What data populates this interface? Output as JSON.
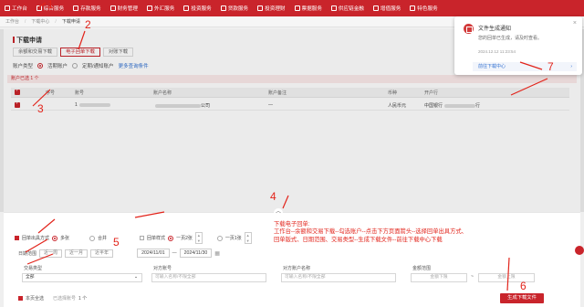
{
  "nav": {
    "items": [
      "工作台",
      "综合服务",
      "存款服务",
      "财务管理",
      "外汇服务",
      "投资服务",
      "贷款服务",
      "投资理财",
      "票据服务",
      "供应链金融",
      "增值服务",
      "特色服务"
    ]
  },
  "breadcrumb": {
    "items": [
      "工作台",
      "下载中心",
      "下载申请"
    ]
  },
  "panel": {
    "title": "下载申请",
    "tabs": [
      "余额和交易下载",
      "电子回单下载",
      "对账下载"
    ],
    "account_type_label": "账户类型",
    "account_opt1": "活期账户",
    "account_opt2": "定期/通知账户",
    "more_link": "更多查询条件",
    "selected_text": "账户已选 1 个"
  },
  "table": {
    "headers": [
      "序号",
      "账号",
      "账户名称",
      "账户备注",
      "币种",
      "开户行"
    ],
    "rows": [
      {
        "index": "1",
        "account": "1",
        "name": "公司",
        "remark": "—",
        "currency": "人民币元",
        "bank": "中国银行",
        "bank_tail": "行"
      }
    ]
  },
  "bottom": {
    "fold_icon": "chevron-up-icon",
    "output_label": "回单出具方式",
    "output_opt1": "多张",
    "output_opt2": "合并",
    "style_label": "回单样式",
    "style_opt1": "一页2张",
    "style_opt2": "一页1张",
    "range_label": "日期范围",
    "range_opts": [
      "近一周",
      "近一月",
      "近半年"
    ],
    "date_start": "2024/11/01",
    "date_sep": "—",
    "date_end": "2024/11/30",
    "trade_type_label": "交易类型",
    "trade_type_value": "全部",
    "peer_account_label": "对方账号",
    "peer_account_placeholder": "可输入名称/不限全部",
    "peer_name_label": "对方账户名称",
    "peer_name_placeholder": "可输入名称/不限全部",
    "amount_label": "金额范围",
    "amount_min": "金额下限",
    "amount_sep": "~",
    "amount_max": "金额上限",
    "select_all": "本页全选",
    "selected_count": "已选择账号",
    "selected_count_num": "1 个",
    "generate_button": "生成下载文件"
  },
  "toast": {
    "title": "文件生成通知",
    "body": "您的回单已生成，请及时查看。",
    "time": "2024.12.12 11:23:54",
    "link": "前往下载中心",
    "close": "×"
  },
  "annotation": {
    "numbers": [
      "1",
      "2",
      "3",
      "4",
      "5",
      "6",
      "7"
    ],
    "title": "下载电子回单:",
    "line1": "工作台--余额和交易下载--勾选账户--点击下方页面箭头--选择回单出具方式、",
    "line2": "回单版式、日期范围、交易类型--生成下载文件--前往下载中心下载"
  },
  "colors": {
    "brand_red": "#c9242b",
    "annotation_red": "#e2231a",
    "link_blue": "#2f6fd1"
  }
}
